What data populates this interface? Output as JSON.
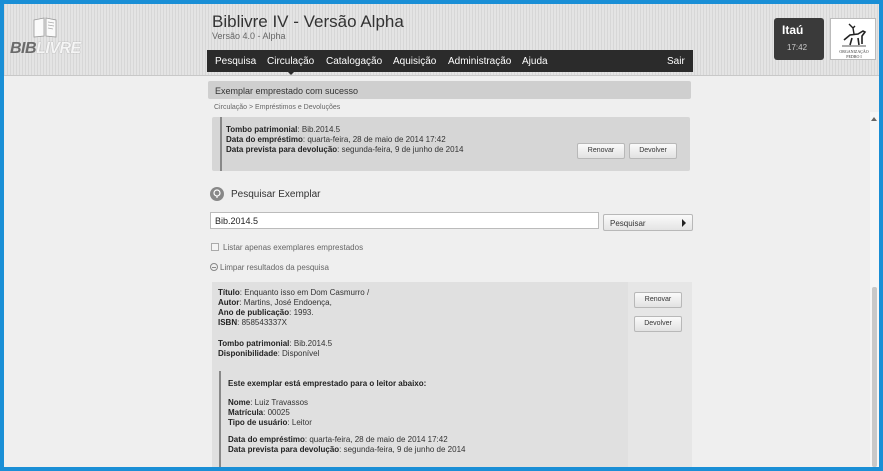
{
  "header": {
    "logo_text_dark": "BIB",
    "logo_text_light": "LIVRE",
    "app_title": "Biblivre IV - Versão Alpha",
    "app_version": "Versão 4.0 - Alpha",
    "menu": [
      {
        "label": "Pesquisa"
      },
      {
        "label": "Circulação"
      },
      {
        "label": "Catalogação"
      },
      {
        "label": "Aquisição"
      },
      {
        "label": "Administração"
      },
      {
        "label": "Ajuda"
      }
    ],
    "logout_label": "Sair",
    "library_name": "Itaú",
    "clock": "17:42",
    "org_logo_text": "ORGANIZAÇÃO PEDRO I"
  },
  "message": "Exemplar emprestado com sucesso",
  "breadcrumb": "Circulação > Empréstimos e Devoluções",
  "loan_summary": {
    "tombo_label": "Tombo patrimonial",
    "tombo_value": ": Bib.2014.5",
    "loan_date_label": "Data do empréstimo",
    "loan_date_value": ": quarta-feira, 28 de maio de 2014 17:42",
    "due_date_label": "Data prevista para devolução",
    "due_date_value": ": segunda-feira, 9 de junho de 2014",
    "renew_label": "Renovar",
    "return_label": "Devolver"
  },
  "search": {
    "title": "Pesquisar Exemplar",
    "input_value": "Bib.2014.5",
    "button_label": "Pesquisar",
    "only_loaned_label": "Listar apenas exemplares emprestados",
    "clear_label": "Limpar resultados da pesquisa"
  },
  "result": {
    "title_label": "Título",
    "title_value": ": Enquanto isso em Dom Casmurro /",
    "author_label": "Autor",
    "author_value": ": Martins, José Endoença,",
    "year_label": "Ano de publicação",
    "year_value": ": 1993.",
    "isbn_label": "ISBN",
    "isbn_value": ": 858543337X",
    "tombo_label": "Tombo patrimonial",
    "tombo_value": ": Bib.2014.5",
    "availability_label": "Disponibilidade",
    "availability_value": ": Disponível",
    "renew_label": "Renovar",
    "return_label": "Devolver",
    "reader_heading": "Este exemplar está emprestado para o leitor abaixo:",
    "reader_name_label": "Nome",
    "reader_name_value": ": Luiz Travassos",
    "enrollment_label": "Matrícula",
    "enrollment_value": ": 00025",
    "user_type_label": "Tipo de usuário",
    "user_type_value": ": Leitor",
    "loan_date_label": "Data do empréstimo",
    "loan_date_value": ": quarta-feira, 28 de maio de 2014 17:42",
    "due_date_label": "Data prevista para devolução",
    "due_date_value": ": segunda-feira, 9 de junho de 2014"
  }
}
